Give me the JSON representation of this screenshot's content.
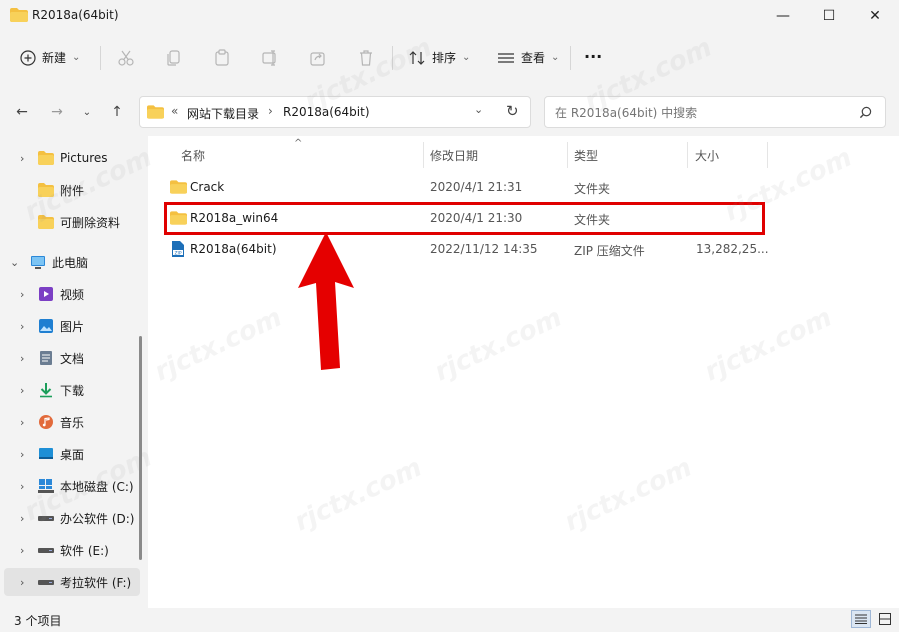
{
  "window": {
    "title": "R2018a(64bit)",
    "minimize_glyph": "—",
    "maximize_glyph": "☐",
    "close_glyph": "✕"
  },
  "toolbar": {
    "new_label": "新建",
    "new_chevron": "⌄",
    "sort_label": "排序",
    "sort_chevron": "⌄",
    "view_label": "查看",
    "view_chevron": "⌄",
    "more_label": "···"
  },
  "navigation": {
    "back": "←",
    "forward": "→",
    "recent": "⌄",
    "up": "↑",
    "breadcrumb_overflow": "«",
    "crumbs": [
      "网站下载目录",
      "R2018a(64bit)"
    ],
    "separator": "›",
    "dropdown": "⌄",
    "refresh": "↻"
  },
  "search": {
    "placeholder": "在 R2018a(64bit) 中搜索"
  },
  "sidebar": {
    "items": [
      {
        "label": "Pictures",
        "chevron": "›"
      },
      {
        "label": "附件",
        "chevron": ""
      },
      {
        "label": "可删除资料",
        "chevron": ""
      },
      {
        "label": "此电脑",
        "chevron": "⌄"
      },
      {
        "label": "视频",
        "chevron": "›"
      },
      {
        "label": "图片",
        "chevron": "›"
      },
      {
        "label": "文档",
        "chevron": "›"
      },
      {
        "label": "下载",
        "chevron": "›"
      },
      {
        "label": "音乐",
        "chevron": "›"
      },
      {
        "label": "桌面",
        "chevron": "›"
      },
      {
        "label": "本地磁盘 (C:)",
        "chevron": "›"
      },
      {
        "label": "办公软件 (D:)",
        "chevron": "›"
      },
      {
        "label": "软件 (E:)",
        "chevron": "›"
      },
      {
        "label": "考拉软件 (F:)",
        "chevron": "›"
      }
    ]
  },
  "file_list": {
    "sort_indicator": "^",
    "columns": [
      "名称",
      "修改日期",
      "类型",
      "大小"
    ],
    "rows": [
      {
        "name": "Crack",
        "date": "2020/4/1 21:31",
        "type": "文件夹",
        "size": ""
      },
      {
        "name": "R2018a_win64",
        "date": "2020/4/1 21:30",
        "type": "文件夹",
        "size": ""
      },
      {
        "name": "R2018a(64bit)",
        "date": "2022/11/12 14:35",
        "type": "ZIP 压缩文件",
        "size": "13,282,25..."
      }
    ]
  },
  "status": {
    "count": "3 个项目"
  },
  "watermark": {
    "text": "rjctx.com"
  },
  "colors": {
    "folder": "#f4c041",
    "highlight": "#e00000",
    "arrow": "#e50000"
  }
}
